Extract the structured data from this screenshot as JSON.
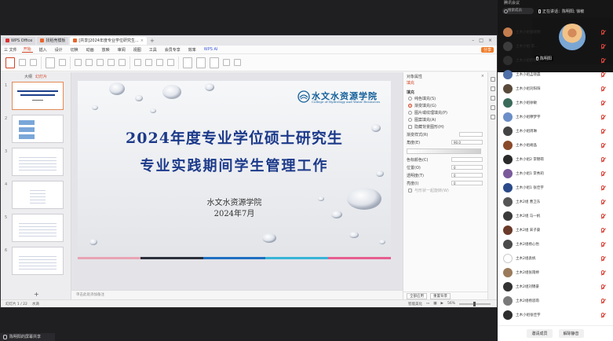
{
  "window": {
    "tabs": [
      {
        "label": "WPS Office",
        "icon": "wps-icon"
      },
      {
        "label": "找稻壳模板",
        "icon": "docer-icon"
      },
      {
        "label": "[共享]2024年度专业学位研究生...",
        "icon": "ppt-icon"
      }
    ]
  },
  "menubar": {
    "file": "三 文件",
    "items": [
      "开始",
      "插入",
      "设计",
      "切换",
      "动画",
      "放映",
      "审阅",
      "视图",
      "工具",
      "会员专享",
      "效率"
    ],
    "wps_ai": "WPS AI",
    "share": "分享"
  },
  "thumbs": {
    "head_outline": "大纲",
    "head_slides": "幻灯片",
    "numbers": [
      "1",
      "2",
      "3",
      "4",
      "5",
      "6"
    ]
  },
  "slide": {
    "logo_cn": "水文水资源学院",
    "logo_en": "College of Hydrology and Water Resources",
    "title1": "2024年度专业学位硕士研究生",
    "title2": "专业实践期间学生管理工作",
    "college": "水文水资源学院",
    "date": "2024年7月"
  },
  "notes": "单击此处添加备注",
  "props": {
    "title": "对象属性",
    "tab": "填充",
    "section": "填充",
    "options": [
      "纯色填充(S)",
      "渐变填充(G)",
      "图片或纹理填充(P)",
      "图案填充(A)",
      "隐藏背景图形(H)"
    ],
    "rows": [
      "渐变样式(R)",
      "角度(E)",
      "色标颜色(C)",
      "位置(O)",
      "透明度(T)",
      "亮度(I)"
    ],
    "angle_value": "90.0",
    "position_value": "0",
    "transparency_value": "0",
    "brightness_value": "0",
    "rotate_with_shape": "与形状一起旋转(W)",
    "apply_all": "全部应用",
    "reset_bg": "重置背景"
  },
  "status": {
    "slide_counter": "幻灯片 1 / 22",
    "theme": "水滴",
    "notes_btn": "智能美化",
    "zoom": "56%"
  },
  "share_footer": {
    "name": "陈明阳的屏幕共享"
  },
  "panel": {
    "title": "腾讯会议",
    "search_placeholder": "搜索成员",
    "speaking_label": "正在讲话：陈明阳; 徐敏",
    "video_name": "陈明阳",
    "participants": [
      {
        "name": "土木小组张晓明",
        "color": "#c47d4f"
      },
      {
        "name": "土木小组-李...",
        "color": "#3c3c3c"
      },
      {
        "name": "土木小组何静怡",
        "color": "#2e2e2e"
      },
      {
        "name": "土木小组孟晓晨",
        "color": "#4f6fa8"
      },
      {
        "name": "土木小组刘阳阳",
        "color": "#5a4a3a"
      },
      {
        "name": "土木小组徐敏",
        "color": "#3a6a5a"
      },
      {
        "name": "土木小组穆梦宇",
        "color": "#6a8ec8"
      },
      {
        "name": "土木小组周琳",
        "color": "#444444"
      },
      {
        "name": "土木小组胡晶",
        "color": "#8a4a2a"
      },
      {
        "name": "土木小组2 李锦萌",
        "color": "#2a2a2a"
      },
      {
        "name": "土木小组1 李秀莉",
        "color": "#7a5a9a"
      },
      {
        "name": "土木小组1 张佳宇",
        "color": "#2a4a8a"
      },
      {
        "name": "土木2组 曹卫东",
        "color": "#555555"
      },
      {
        "name": "土木2组 马一帆",
        "color": "#3a3a3a"
      },
      {
        "name": "土木2组 宋子豪",
        "color": "#6a3a2a"
      },
      {
        "name": "土木2组杨心怡",
        "color": "#4a4a4a"
      },
      {
        "name": "土木2组袁帆",
        "color": "#ffffff"
      },
      {
        "name": "土木2组张雨婷",
        "color": "#9a7a5a"
      },
      {
        "name": "土木2组刘锦豪",
        "color": "#333333"
      },
      {
        "name": "土木2组杨思雨",
        "color": "#7a7a7a"
      },
      {
        "name": "土木小组张佳宇",
        "color": "#2e2e2e"
      },
      {
        "name": "土木2组朱婷",
        "color": "#222222"
      }
    ],
    "btn_invite": "邀请成员",
    "btn_mute_all": "解除静音"
  }
}
